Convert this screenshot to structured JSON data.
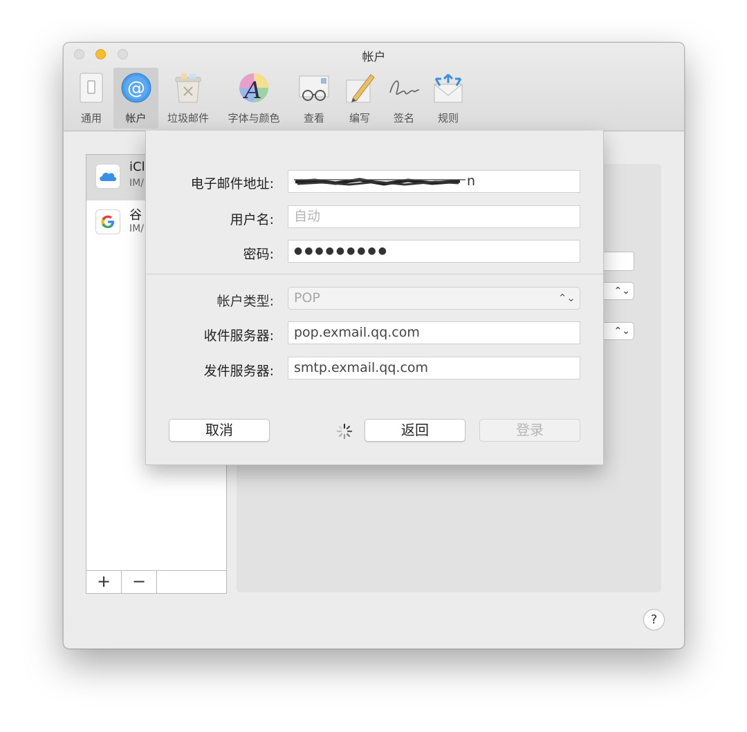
{
  "window": {
    "title": "帐户"
  },
  "toolbar": {
    "items": [
      {
        "label": "通用",
        "icon": "general-switch-icon",
        "selected": false
      },
      {
        "label": "帐户",
        "icon": "at-sign-icon",
        "selected": true
      },
      {
        "label": "垃圾邮件",
        "icon": "junk-mail-bin-icon",
        "selected": false
      },
      {
        "label": "字体与颜色",
        "icon": "font-color-wheel-icon",
        "selected": false
      },
      {
        "label": "查看",
        "icon": "glasses-envelope-icon",
        "selected": false
      },
      {
        "label": "编写",
        "icon": "pencil-paper-icon",
        "selected": false
      },
      {
        "label": "签名",
        "icon": "signature-icon",
        "selected": false
      },
      {
        "label": "规则",
        "icon": "rules-envelope-icon",
        "selected": false
      }
    ]
  },
  "accounts": [
    {
      "name": "iCl",
      "type": "IM/",
      "icon": "icloud-icon",
      "selected": true
    },
    {
      "name": "谷",
      "type": "IM/",
      "icon": "google-icon",
      "selected": false
    }
  ],
  "account_list_controls": {
    "add": "+",
    "remove": "−"
  },
  "help": {
    "label": "?"
  },
  "sheet": {
    "email_label": "电子邮件地址:",
    "email_value_tail": "n",
    "username_label": "用户名:",
    "username_placeholder": "自动",
    "password_label": "密码:",
    "password_mask": "●●●●●●●●●",
    "account_type_label": "帐户类型:",
    "account_type_value": "POP",
    "incoming_label": "收件服务器:",
    "incoming_value": "pop.exmail.qq.com",
    "outgoing_label": "发件服务器:",
    "outgoing_value": "smtp.exmail.qq.com",
    "cancel_label": "取消",
    "back_label": "返回",
    "login_label": "登录"
  }
}
